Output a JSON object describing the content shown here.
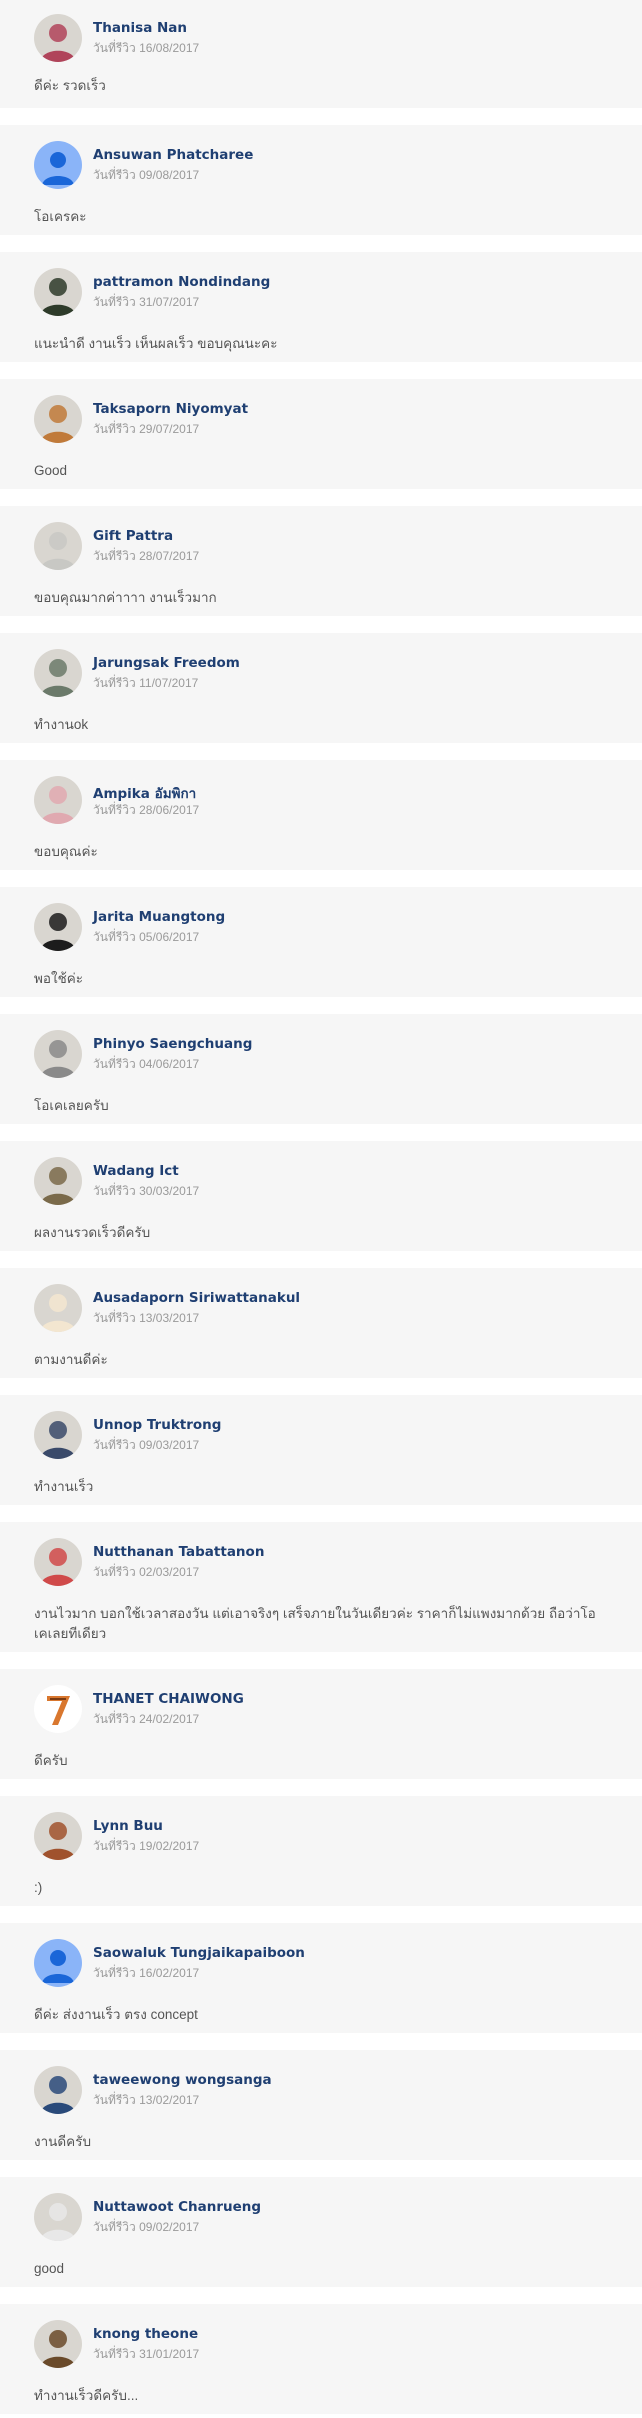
{
  "reviews": [
    {
      "name": "Thanisa Nan",
      "date_label": "วันที่รีวิว",
      "date": "16/08/2017",
      "comment": "ดีค่ะ รวดเร็ว",
      "avatar": "photo",
      "avatar_color": "#b0445a"
    },
    {
      "name": "Ansuwan Phatcharee",
      "date_label": "วันที่รีวิว",
      "date": "09/08/2017",
      "comment": "โอเครคะ",
      "avatar": "default-person",
      "avatar_color": "#8ab4f8"
    },
    {
      "name": "pattramon Nondindang",
      "date_label": "วันที่รีวิว",
      "date": "31/07/2017",
      "comment": "แนะนำดี งานเร็ว เห็นผลเร็ว ขอบคุณนะคะ",
      "avatar": "photo",
      "avatar_color": "#2e3b2a"
    },
    {
      "name": "Taksaporn Niyomyat",
      "date_label": "วันที่รีวิว",
      "date": "29/07/2017",
      "comment": "Good",
      "avatar": "photo",
      "avatar_color": "#c07a3a"
    },
    {
      "name": "Gift Pattra",
      "date_label": "วันที่รีวิว",
      "date": "28/07/2017",
      "comment": "ขอบคุณมากค่าาาา งานเร็วมาก",
      "avatar": "photo",
      "avatar_color": "#c8c8c4"
    },
    {
      "name": "Jarungsak Freedom",
      "date_label": "วันที่รีวิว",
      "date": "11/07/2017",
      "comment": "ทำงานok",
      "avatar": "photo",
      "avatar_color": "#6b7a6a"
    },
    {
      "name": "Ampika อัมพิกา",
      "date_label": "วันที่รีวิว",
      "date": "28/06/2017",
      "comment": "ขอบคุณค่ะ",
      "avatar": "photo",
      "avatar_color": "#e0a9b0"
    },
    {
      "name": "Jarita Muangtong",
      "date_label": "วันที่รีวิว",
      "date": "05/06/2017",
      "comment": "พอใช้ค่ะ",
      "avatar": "photo",
      "avatar_color": "#1c1c1c"
    },
    {
      "name": "Phinyo Saengchuang",
      "date_label": "วันที่รีวิว",
      "date": "04/06/2017",
      "comment": "โอเคเลยครับ",
      "avatar": "photo",
      "avatar_color": "#8a8a8a"
    },
    {
      "name": "Wadang Ict",
      "date_label": "วันที่รีวิว",
      "date": "30/03/2017",
      "comment": "ผลงานรวดเร็วดีครับ",
      "avatar": "photo",
      "avatar_color": "#7a6a4a"
    },
    {
      "name": "Ausadaporn Siriwattanakul",
      "date_label": "วันที่รีวิว",
      "date": "13/03/2017",
      "comment": "ตามงานดีค่ะ",
      "avatar": "photo",
      "avatar_color": "#f3e6d0"
    },
    {
      "name": "Unnop Truktrong",
      "date_label": "วันที่รีวิว",
      "date": "09/03/2017",
      "comment": "ทำงานเร็ว",
      "avatar": "photo",
      "avatar_color": "#3a4a6a"
    },
    {
      "name": "Nutthanan Tabattanon",
      "date_label": "วันที่รีวิว",
      "date": "02/03/2017",
      "comment": "งานไวมาก บอกใช้เวลาสองวัน แต่เอาจริงๆ เสร็จภายในวันเดียวค่ะ ราคาก็ไม่แพงมากด้วย ถือว่าโอเคเลยทีเดียว",
      "avatar": "photo",
      "avatar_color": "#d04a4a"
    },
    {
      "name": "THANET CHAIWONG",
      "date_label": "วันที่รีวิว",
      "date": "24/02/2017",
      "comment": "ดีครับ",
      "avatar": "logo-7",
      "avatar_color": "#d9772e"
    },
    {
      "name": "Lynn Buu",
      "date_label": "วันที่รีวิว",
      "date": "19/02/2017",
      "comment": ":)",
      "avatar": "photo",
      "avatar_color": "#a0522d"
    },
    {
      "name": "Saowaluk Tungjaikapaiboon",
      "date_label": "วันที่รีวิว",
      "date": "16/02/2017",
      "comment": "ดีค่ะ ส่งงานเร็ว ตรง concept",
      "avatar": "default-person",
      "avatar_color": "#8ab4f8"
    },
    {
      "name": "taweewong wongsanga",
      "date_label": "วันที่รีวิว",
      "date": "13/02/2017",
      "comment": "งานดีครับ",
      "avatar": "photo",
      "avatar_color": "#2a4a7a"
    },
    {
      "name": "Nuttawoot Chanrueng",
      "date_label": "วันที่รีวิว",
      "date": "09/02/2017",
      "comment": "good",
      "avatar": "photo",
      "avatar_color": "#e8e8e8"
    },
    {
      "name": "knong theone",
      "date_label": "วันที่รีวิว",
      "date": "31/01/2017",
      "comment": "ทำงานเร็วดีครับ...",
      "avatar": "photo",
      "avatar_color": "#6a4a2a"
    }
  ]
}
